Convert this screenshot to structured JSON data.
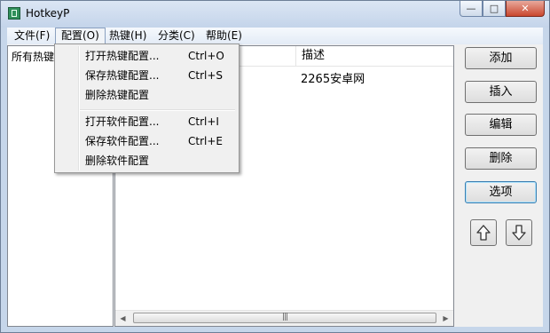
{
  "window": {
    "title": "HotkeyP"
  },
  "titlebar": {
    "minimize_glyph": "—",
    "maximize_glyph": "□",
    "close_glyph": "✕"
  },
  "menubar": [
    {
      "label": "文件(F)"
    },
    {
      "label": "配置(O)"
    },
    {
      "label": "热键(H)"
    },
    {
      "label": "分类(C)"
    },
    {
      "label": "帮助(E)"
    }
  ],
  "tree": {
    "label": "所有热键"
  },
  "list": {
    "column_desc": "描述",
    "rows": [
      {
        "desc": "2265安卓网"
      }
    ],
    "scroll_thumb_grip": "|||"
  },
  "config_menu": {
    "items": [
      {
        "label": "打开热键配置...",
        "shortcut": "Ctrl+O"
      },
      {
        "label": "保存热键配置...",
        "shortcut": "Ctrl+S"
      },
      {
        "label": "删除热键配置",
        "shortcut": ""
      },
      {
        "label": "打开软件配置...",
        "shortcut": "Ctrl+I"
      },
      {
        "label": "保存软件配置...",
        "shortcut": "Ctrl+E"
      },
      {
        "label": "删除软件配置",
        "shortcut": ""
      }
    ]
  },
  "buttons": {
    "add": "添加",
    "insert": "插入",
    "edit": "编辑",
    "delete": "删除",
    "options": "选项"
  },
  "icons": {
    "app": "hotkeyp-app-icon",
    "move_up": "arrow-up-icon",
    "move_down": "arrow-down-icon"
  },
  "colors": {
    "title_bar": "#c4d4ea",
    "close_button": "#c9472e",
    "focus_border": "#3c7fb1"
  }
}
